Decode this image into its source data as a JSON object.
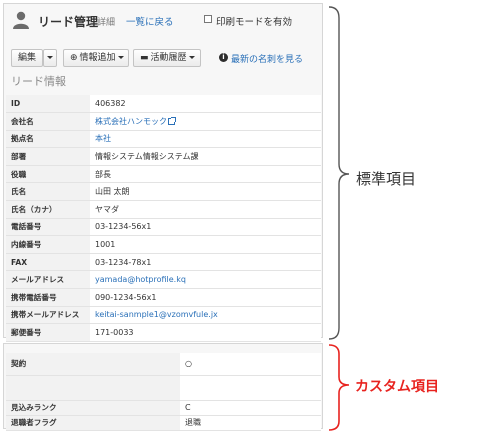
{
  "header": {
    "title": "リード管理",
    "subtitle": "詳細",
    "back_link": "一覧に戻る",
    "print_label": "印刷モードを有効"
  },
  "toolbar": {
    "edit_label": "編集",
    "add_info_label": "情報追加",
    "activity_label": "活動履歴",
    "latest_card_link": "最新の名刺を見る"
  },
  "section_title": "リード情報",
  "standard_fields": [
    {
      "key": "ID",
      "value": "406382"
    },
    {
      "key": "会社名",
      "value": "株式会社ハンモック"
    },
    {
      "key": "拠点名",
      "value": "本社"
    },
    {
      "key": "部署",
      "value": "情報システム情報システム課"
    },
    {
      "key": "役職",
      "value": "部長"
    },
    {
      "key": "氏名",
      "value": "山田 太朗"
    },
    {
      "key": "氏名（カナ）",
      "value": "ヤマダ"
    },
    {
      "key": "電話番号",
      "value": "03-1234-56x1"
    },
    {
      "key": "内線番号",
      "value": "1001"
    },
    {
      "key": "FAX",
      "value": "03-1234-78x1"
    },
    {
      "key": "メールアドレス",
      "value": "yamada@hotprofile.kq"
    },
    {
      "key": "携帯電話番号",
      "value": "090-1234-56x1"
    },
    {
      "key": "携帯メールアドレス",
      "value": "keitai-sanmple1@vzomvfule.jx"
    },
    {
      "key": "郵便番号",
      "value": "171-0033"
    }
  ],
  "custom_fields": [
    {
      "key": "契約",
      "value": "○"
    },
    {
      "key": "",
      "value": ""
    },
    {
      "key": "見込みランク",
      "value": "C"
    },
    {
      "key": "退職者フラグ",
      "value": "退職"
    }
  ],
  "annotations": {
    "standard_label": "標準項目",
    "custom_label": "カスタム項目"
  },
  "colors": {
    "link": "#2a70b8",
    "custom_accent": "#e8231f",
    "bracket_standard": "#555555"
  },
  "icons": [
    "user-icon",
    "plus-circle-icon",
    "briefcase-icon",
    "info-icon",
    "external-link-icon"
  ]
}
